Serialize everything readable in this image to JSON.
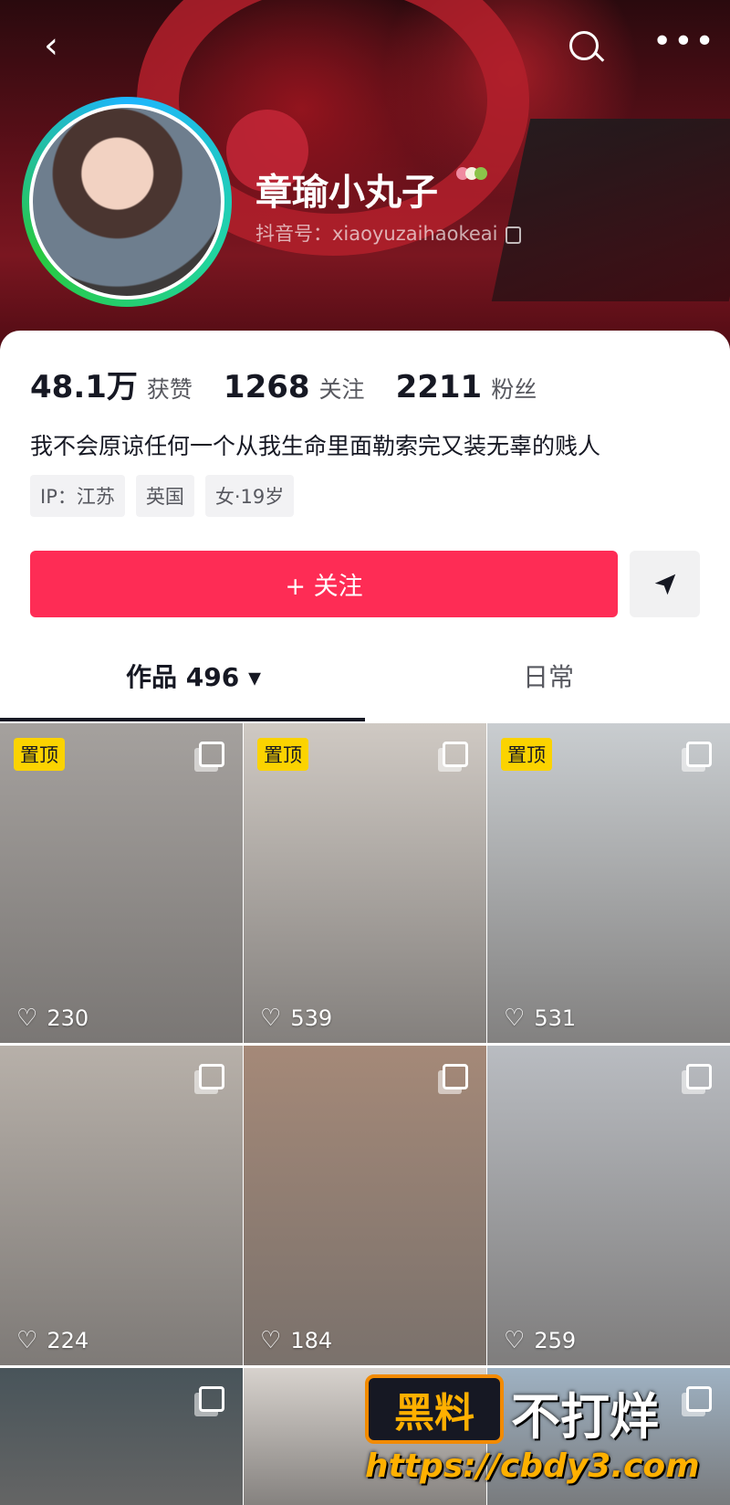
{
  "header": {
    "back_icon": "chevron-left-icon",
    "search_icon": "search-icon",
    "more_icon": "more-dots-icon",
    "more_glyph": "•••"
  },
  "profile": {
    "name": "章瑜小丸子",
    "douyin_id": "抖音号：xiaoyuzaihaokeai"
  },
  "stats": [
    {
      "value": "48.1万",
      "label": "获赞"
    },
    {
      "value": "1268",
      "label": "关注"
    },
    {
      "value": "2211",
      "label": "粉丝"
    }
  ],
  "bio": "我不会原谅任何一个从我生命里面勒索完又装无辜的贱人",
  "tags": [
    "IP：江苏",
    "英国",
    "女·19岁"
  ],
  "actions": {
    "follow_label": "+ 关注",
    "share_icon": "send-icon"
  },
  "tabs": {
    "works": "作品 496 ▾",
    "daily": "日常"
  },
  "videos": [
    {
      "pinned": "置顶",
      "likes": "230",
      "bg": "#a5a19e"
    },
    {
      "pinned": "置顶",
      "likes": "539",
      "bg": "#cfc9c3"
    },
    {
      "pinned": "置顶",
      "likes": "531",
      "bg": "#c9cdd0"
    },
    {
      "pinned": "",
      "likes": "224",
      "bg": "#b7b0a9"
    },
    {
      "pinned": "",
      "likes": "184",
      "bg": "#a58978"
    },
    {
      "pinned": "",
      "likes": "259",
      "bg": "#b9bcc1"
    },
    {
      "pinned": "",
      "likes": "",
      "bg": "#48545a"
    },
    {
      "pinned": "",
      "likes": "",
      "bg": "#d7d2cd"
    },
    {
      "pinned": "",
      "likes": "",
      "bg": "#9fb2c3"
    }
  ],
  "watermark": {
    "badge": "黑料",
    "text": "不打烊",
    "url": "https://cbdy3.com"
  },
  "colors": {
    "accent": "#fe2c55",
    "pin": "#fbd300"
  }
}
